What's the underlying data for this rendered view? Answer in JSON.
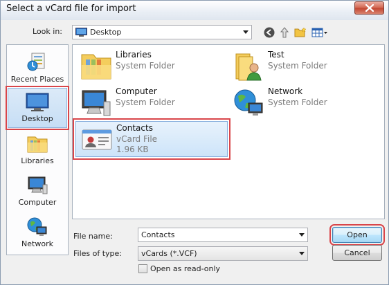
{
  "window": {
    "title": "Select a vCard file for import"
  },
  "lookin": {
    "label": "Look in:",
    "value": "Desktop"
  },
  "places": [
    {
      "label": "Recent Places",
      "icon": "recent-places-icon",
      "selected": false
    },
    {
      "label": "Desktop",
      "icon": "desktop-icon",
      "selected": true
    },
    {
      "label": "Libraries",
      "icon": "libraries-icon",
      "selected": false
    },
    {
      "label": "Computer",
      "icon": "computer-icon",
      "selected": false
    },
    {
      "label": "Network",
      "icon": "network-icon",
      "selected": false
    }
  ],
  "files": [
    {
      "name": "Libraries",
      "type": "System Folder",
      "size": "",
      "icon": "libraries-folder-icon"
    },
    {
      "name": "Test",
      "type": "System Folder",
      "size": "",
      "icon": "user-folder-icon"
    },
    {
      "name": "Computer",
      "type": "System Folder",
      "size": "",
      "icon": "computer-icon"
    },
    {
      "name": "Network",
      "type": "System Folder",
      "size": "",
      "icon": "network-icon"
    },
    {
      "name": "Contacts",
      "type": "vCard File",
      "size": "1.96 KB",
      "icon": "vcard-icon",
      "selected": true
    }
  ],
  "bottom": {
    "filename_label": "File name:",
    "filename_value": "Contacts",
    "filetype_label": "Files of type:",
    "filetype_value": "vCards (*.VCF)",
    "readonly_label": "Open as read-only",
    "open_label": "Open",
    "cancel_label": "Cancel"
  },
  "colors": {
    "highlight": "#d9454a",
    "selection": "#cde4f9"
  }
}
